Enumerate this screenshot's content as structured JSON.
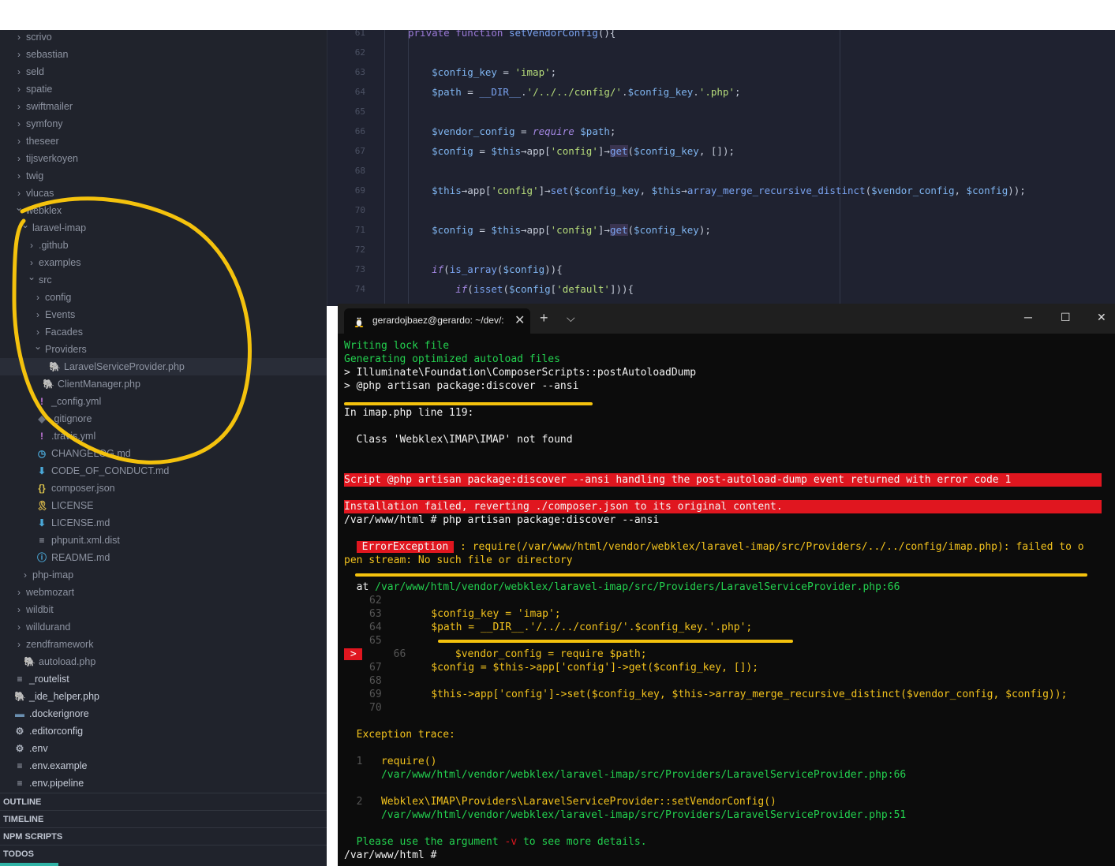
{
  "sidebar": {
    "items": [
      {
        "label": "scrivo",
        "type": "folder",
        "expanded": false,
        "depth": 0
      },
      {
        "label": "sebastian",
        "type": "folder",
        "expanded": false,
        "depth": 0
      },
      {
        "label": "seld",
        "type": "folder",
        "expanded": false,
        "depth": 0
      },
      {
        "label": "spatie",
        "type": "folder",
        "expanded": false,
        "depth": 0
      },
      {
        "label": "swiftmailer",
        "type": "folder",
        "expanded": false,
        "depth": 0
      },
      {
        "label": "symfony",
        "type": "folder",
        "expanded": false,
        "depth": 0
      },
      {
        "label": "theseer",
        "type": "folder",
        "expanded": false,
        "depth": 0
      },
      {
        "label": "tijsverkoyen",
        "type": "folder",
        "expanded": false,
        "depth": 0
      },
      {
        "label": "twig",
        "type": "folder",
        "expanded": false,
        "depth": 0
      },
      {
        "label": "vlucas",
        "type": "folder",
        "expanded": false,
        "depth": 0
      },
      {
        "label": "webklex",
        "type": "folder",
        "expanded": true,
        "depth": 0
      },
      {
        "label": "laravel-imap",
        "type": "folder",
        "expanded": true,
        "depth": 1
      },
      {
        "label": ".github",
        "type": "folder",
        "expanded": false,
        "depth": 2
      },
      {
        "label": "examples",
        "type": "folder",
        "expanded": false,
        "depth": 2
      },
      {
        "label": "src",
        "type": "folder",
        "expanded": true,
        "depth": 2
      },
      {
        "label": "config",
        "type": "folder",
        "expanded": false,
        "depth": 3
      },
      {
        "label": "Events",
        "type": "folder",
        "expanded": false,
        "depth": 3
      },
      {
        "label": "Facades",
        "type": "folder",
        "expanded": false,
        "depth": 3
      },
      {
        "label": "Providers",
        "type": "folder",
        "expanded": true,
        "depth": 3
      },
      {
        "label": "LaravelServiceProvider.php",
        "type": "php",
        "depth": 4,
        "selected": true
      },
      {
        "label": "ClientManager.php",
        "type": "php",
        "depth": 3
      },
      {
        "label": "_config.yml",
        "type": "yml",
        "depth": 2
      },
      {
        "label": ".gitignore",
        "type": "git",
        "depth": 2
      },
      {
        "label": ".travis.yml",
        "type": "yml",
        "depth": 2
      },
      {
        "label": "CHANGELOG.md",
        "type": "changelog",
        "depth": 2
      },
      {
        "label": "CODE_OF_CONDUCT.md",
        "type": "md",
        "depth": 2
      },
      {
        "label": "composer.json",
        "type": "json",
        "depth": 2
      },
      {
        "label": "LICENSE",
        "type": "license",
        "depth": 2
      },
      {
        "label": "LICENSE.md",
        "type": "md",
        "depth": 2
      },
      {
        "label": "phpunit.xml.dist",
        "type": "text",
        "depth": 2
      },
      {
        "label": "README.md",
        "type": "info",
        "depth": 2
      },
      {
        "label": "php-imap",
        "type": "folder",
        "expanded": false,
        "depth": 1
      },
      {
        "label": "webmozart",
        "type": "folder",
        "expanded": false,
        "depth": 0
      },
      {
        "label": "wildbit",
        "type": "folder",
        "expanded": false,
        "depth": 0
      },
      {
        "label": "willdurand",
        "type": "folder",
        "expanded": false,
        "depth": 0
      },
      {
        "label": "zendframework",
        "type": "folder",
        "expanded": false,
        "depth": 0
      },
      {
        "label": "autoload.php",
        "type": "php",
        "depth": 0
      },
      {
        "label": "_routelist",
        "type": "text",
        "depth": -1
      },
      {
        "label": "_ide_helper.php",
        "type": "php",
        "depth": -1
      },
      {
        "label": ".dockerignore",
        "type": "docker",
        "depth": -1
      },
      {
        "label": ".editorconfig",
        "type": "gear",
        "depth": -1
      },
      {
        "label": ".env",
        "type": "gear",
        "depth": -1
      },
      {
        "label": ".env.example",
        "type": "text",
        "depth": -1
      },
      {
        "label": ".env.pipeline",
        "type": "text",
        "depth": -1
      }
    ],
    "sections": [
      "OUTLINE",
      "TIMELINE",
      "NPM SCRIPTS",
      "TODOS"
    ]
  },
  "editor": {
    "lines": [
      {
        "n": "61",
        "html": "<span class=\"kw\">private function</span> <span class=\"fn\">setVendorConfig</span>(){"
      },
      {
        "n": "62",
        "html": ""
      },
      {
        "n": "63",
        "html": "    <span class=\"var\">$config_key</span> = <span class=\"str\">'imap'</span>;"
      },
      {
        "n": "64",
        "html": "    <span class=\"var\">$path</span> = <span class=\"fn\">__DIR__</span>.<span class=\"str\">'/../../config/'</span>.<span class=\"var\">$config_key</span>.<span class=\"str\">'.php'</span>;"
      },
      {
        "n": "65",
        "html": ""
      },
      {
        "n": "66",
        "html": "    <span class=\"var\">$vendor_config</span> = <span class=\"kwi\">require</span> <span class=\"var\">$path</span>;"
      },
      {
        "n": "67",
        "html": "    <span class=\"var\">$config</span> = <span class=\"var\">$this</span>→app[<span class=\"str\">'config'</span>]→<span class=\"fn hl\">get</span>(<span class=\"var\">$config_key</span>, []);"
      },
      {
        "n": "68",
        "html": ""
      },
      {
        "n": "69",
        "html": "    <span class=\"var\">$this</span>→app[<span class=\"str\">'config'</span>]→<span class=\"fn\">set</span>(<span class=\"var\">$config_key</span>, <span class=\"var\">$this</span>→<span class=\"fn\">array_merge_recursive_distinct</span>(<span class=\"var\">$vendor_config</span>, <span class=\"var\">$config</span>));"
      },
      {
        "n": "70",
        "html": ""
      },
      {
        "n": "71",
        "html": "    <span class=\"var\">$config</span> = <span class=\"var\">$this</span>→app[<span class=\"str\">'config'</span>]→<span class=\"fn hl\">get</span>(<span class=\"var\">$config_key</span>);"
      },
      {
        "n": "72",
        "html": ""
      },
      {
        "n": "73",
        "html": "    <span class=\"kwi\">if</span>(<span class=\"fn\">is_array</span>(<span class=\"var\">$config</span>)){"
      },
      {
        "n": "74",
        "html": "        <span class=\"kwi\">if</span>(<span class=\"fn\">isset</span>(<span class=\"var\">$config</span>[<span class=\"str\">'default'</span>])){"
      }
    ]
  },
  "terminal": {
    "tab_title": "gerardojbaez@gerardo: ~/dev/:",
    "new_tab": "+",
    "dropdown": "⌵",
    "close_tab": "✕",
    "minimize": "─",
    "maximize": "☐",
    "close_window": "✕",
    "lines": {
      "l1": "Writing lock file",
      "l2": "Generating optimized autoload files",
      "l3": "> Illuminate\\Foundation\\ComposerScripts::postAutoloadDump",
      "l4": "> @php artisan package:discover --ansi",
      "l5": "In imap.php line 119:",
      "l6": "  Class 'Webklex\\IMAP\\IMAP' not found",
      "err1": "Script @php artisan package:discover --ansi handling the post-autoload-dump event returned with error code 1",
      "err2": "Installation failed, reverting ./composer.json to its original content.",
      "l7": "/var/www/html # php artisan package:discover --ansi",
      "exc_badge": "ErrorException",
      "exc_msg1": " : require(/var/www/html/vendor/webklex/laravel-imap/src/Providers/../../config/imap.php): failed to o",
      "exc_msg2": "pen stream: No such file or directory",
      "at_label": "at ",
      "at_path": "/var/www/html/vendor/webklex/laravel-imap/src/Providers/LaravelServiceProvider.php",
      "at_line": ":66",
      "src62": "62",
      "src63n": "63",
      "src63": "        $config_key = 'imap';",
      "src64n": "64",
      "src64": "        $path = __DIR__.'/../../config/'.$config_key.'.php';",
      "src65": "65",
      "marker": " > ",
      "src66n": "66",
      "src66": "        $vendor_config = require $path;",
      "src67n": "67",
      "src67": "        $config = $this->app['config']->get($config_key, []);",
      "src68": "68",
      "src69n": "69",
      "src69": "        $this->app['config']->set($config_key, $this->array_merge_recursive_distinct($vendor_config, $config));",
      "src70": "70",
      "trace_title": "Exception trace:",
      "t1n": "1",
      "t1a": "require()",
      "t1b": "/var/www/html/vendor/webklex/laravel-imap/src/Providers/LaravelServiceProvider.php",
      "t1c": ":66",
      "t2n": "2",
      "t2a": "Webklex\\IMAP\\Providers\\LaravelServiceProvider::setVendorConfig()",
      "t2b": "/var/www/html/vendor/webklex/laravel-imap/src/Providers/LaravelServiceProvider.php",
      "t2c": ":51",
      "hint_a": "Please use the argument ",
      "hint_b": "-v",
      "hint_c": " to see more details.",
      "prompt": "/var/www/html # "
    }
  },
  "colors": {
    "annotation": "#f4c20d",
    "error_bg": "#e0161f",
    "term_green": "#23d14f",
    "term_yellow": "#f2c21d"
  }
}
